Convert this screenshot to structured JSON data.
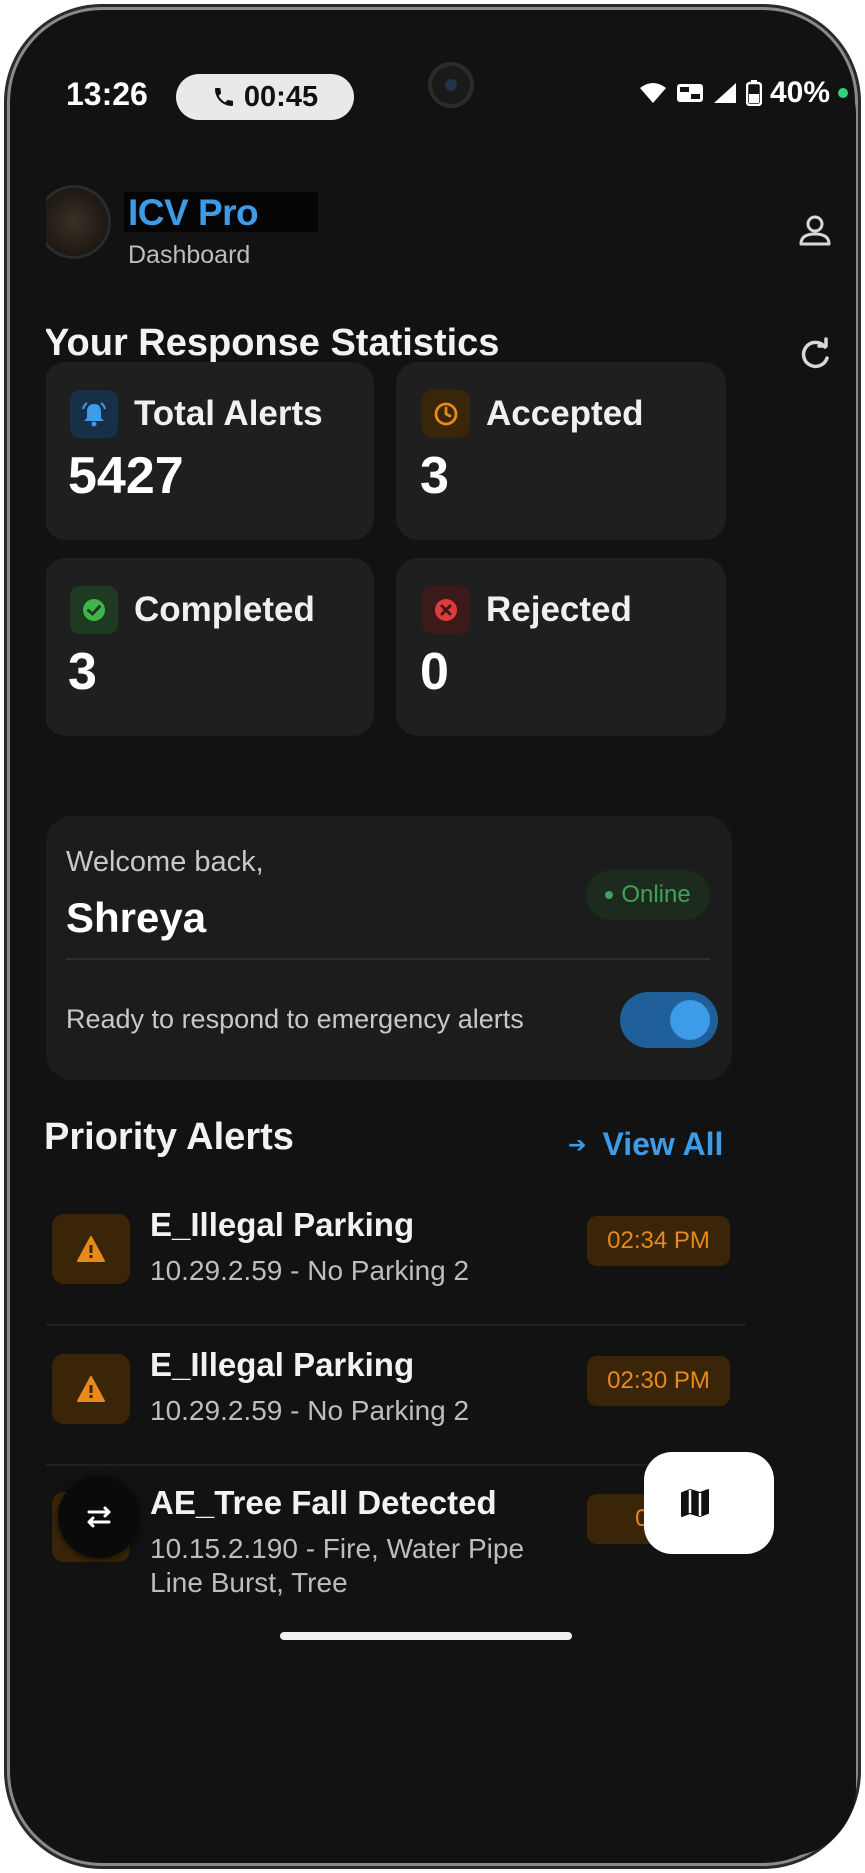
{
  "status_bar": {
    "time": "13:26",
    "call_timer": "00:45",
    "battery": "40%"
  },
  "header": {
    "app_title": "ICV Pro",
    "subtitle": "Dashboard"
  },
  "stats": {
    "title": "Your Response Statistics",
    "cards": [
      {
        "label": "Total Alerts",
        "value": "5427",
        "color": "#3d9be8"
      },
      {
        "label": "Accepted",
        "value": "3",
        "color": "#e8891c"
      },
      {
        "label": "Completed",
        "value": "3",
        "color": "#3fb54a"
      },
      {
        "label": "Rejected",
        "value": "0",
        "color": "#e03b3b"
      }
    ]
  },
  "welcome": {
    "greeting": "Welcome back,",
    "name": "Shreya",
    "status": "Online",
    "ready_text": "Ready to respond to emergency alerts",
    "toggle_on": true
  },
  "alerts": {
    "title": "Priority Alerts",
    "view_all": "View All",
    "items": [
      {
        "title": "E_Illegal Parking",
        "detail": "10.29.2.59 - No Parking 2",
        "time": "02:34 PM",
        "icon": "warning-icon"
      },
      {
        "title": "E_Illegal Parking",
        "detail": "10.29.2.59 - No Parking 2",
        "time": "02:30 PM",
        "icon": "warning-icon"
      },
      {
        "title": "AE_Tree Fall Detected",
        "detail": "10.15.2.190 - Fire, Water Pipe Line Burst, Tree",
        "time": "02:3",
        "icon": "warning-icon"
      }
    ]
  },
  "colors": {
    "accent": "#3d9be8",
    "warning": "#e8891c",
    "success": "#3fb54a",
    "danger": "#e03b3b",
    "background": "#121212"
  }
}
